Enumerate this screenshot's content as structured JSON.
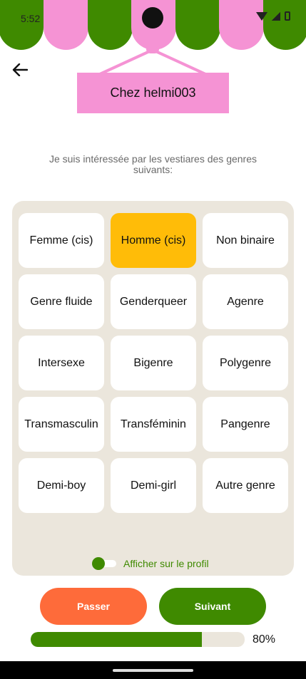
{
  "status_bar": {
    "time": "5:52"
  },
  "header": {
    "shop_name": "Chez helmi003"
  },
  "subtitle": "Je suis intéressée par les vestiares des genres suivants:",
  "options": [
    {
      "label": "Femme (cis)",
      "selected": false
    },
    {
      "label": "Homme (cis)",
      "selected": true
    },
    {
      "label": "Non binaire",
      "selected": false
    },
    {
      "label": "Genre fluide",
      "selected": false
    },
    {
      "label": "Genderqueer",
      "selected": false
    },
    {
      "label": "Agenre",
      "selected": false
    },
    {
      "label": "Intersexe",
      "selected": false
    },
    {
      "label": "Bigenre",
      "selected": false
    },
    {
      "label": "Polygenre",
      "selected": false
    },
    {
      "label": "Transmasculin",
      "selected": false
    },
    {
      "label": "Transféminin",
      "selected": false
    },
    {
      "label": "Pangenre",
      "selected": false
    },
    {
      "label": "Demi-boy",
      "selected": false
    },
    {
      "label": "Demi-girl",
      "selected": false
    },
    {
      "label": "Autre genre",
      "selected": false
    }
  ],
  "toggle": {
    "label": "Afficher sur le profil",
    "on": false
  },
  "buttons": {
    "skip": "Passer",
    "next": "Suivant"
  },
  "progress": {
    "value": 0.8,
    "label": "80%"
  },
  "colors": {
    "green": "#3f8a00",
    "pink": "#f593d4",
    "selected": "#ffbc08",
    "skip": "#fe6b3a",
    "panel": "#ebe6dc"
  }
}
